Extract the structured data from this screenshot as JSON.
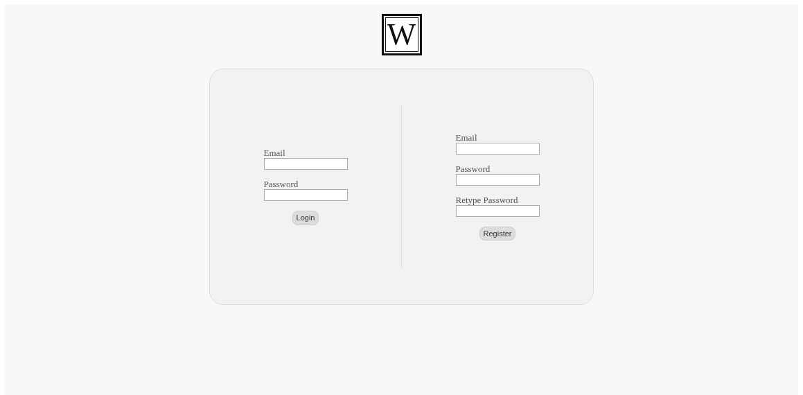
{
  "logo": {
    "text": "W"
  },
  "login": {
    "fields": [
      {
        "label": "Email"
      },
      {
        "label": "Password"
      }
    ],
    "button": "Login"
  },
  "register": {
    "fields": [
      {
        "label": "Email"
      },
      {
        "label": "Password"
      },
      {
        "label": "Retype Password"
      }
    ],
    "button": "Register"
  }
}
